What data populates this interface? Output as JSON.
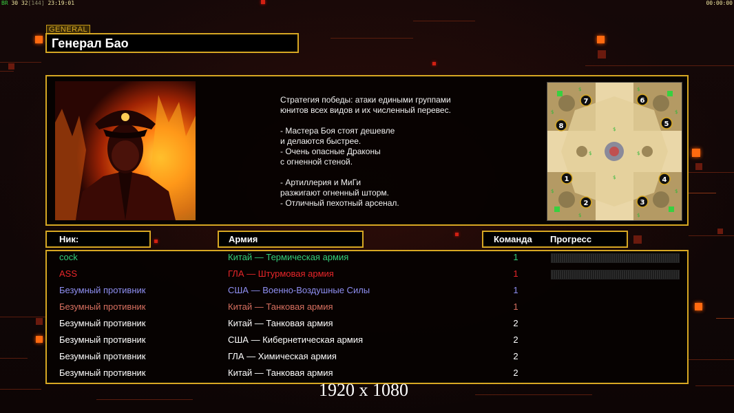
{
  "hud": {
    "left_label": "BR",
    "left_nums": "30 32",
    "left_bracket": "[144]",
    "left_time": "23:19:01",
    "right_time": "00:00:00"
  },
  "general": {
    "tag": "GENERAL",
    "name": "Генерал Бао"
  },
  "description": [
    "Стратегия победы: атаки едиными группами",
    "юнитов всех видов и их численный перевес.",
    "",
    "- Мастера Боя стоят дешевле",
    "и делаются быстрее.",
    "- Очень опасные Драконы",
    "с огненной стеной.",
    "",
    "- Артиллерия и МиГи",
    "разжигают огненный шторм.",
    "- Отличный пехотный арсенал."
  ],
  "minimap": {
    "slots": [
      "7",
      "6",
      "8",
      "5",
      "1",
      "4",
      "2",
      "3"
    ]
  },
  "headers": {
    "nick": "Ник:",
    "army": "Армия",
    "team": "Команда",
    "progress": "Прогресс"
  },
  "players": [
    {
      "nick": "cock",
      "army": "Китай — Термическая армия",
      "team": "1",
      "color": "#35d07a"
    },
    {
      "nick": "ASS",
      "army": "ГЛА — Штурмовая армия",
      "team": "1",
      "color": "#e8262a"
    },
    {
      "nick": "Безумный противник",
      "army": "США — Военно-Воздушные Силы",
      "team": "1",
      "color": "#8f8ff2"
    },
    {
      "nick": "Безумный противник",
      "army": "Китай — Танковая армия",
      "team": "1",
      "color": "#d87060"
    },
    {
      "nick": "Безумный противник",
      "army": "Китай — Танковая армия",
      "team": "2",
      "color": "#ffffff"
    },
    {
      "nick": "Безумный противник",
      "army": "США — Кибернетическая армия",
      "team": "2",
      "color": "#ffffff"
    },
    {
      "nick": "Безумный противник",
      "army": "ГЛА — Химическая армия",
      "team": "2",
      "color": "#ffffff"
    },
    {
      "nick": "Безумный противник",
      "army": "Китай — Танковая армия",
      "team": "2",
      "color": "#ffffff"
    }
  ],
  "watermark": "1920 x 1080",
  "colors": {
    "frame_gold": "#d7a823",
    "accent_orange": "#ff6a10",
    "background": "#120707"
  }
}
